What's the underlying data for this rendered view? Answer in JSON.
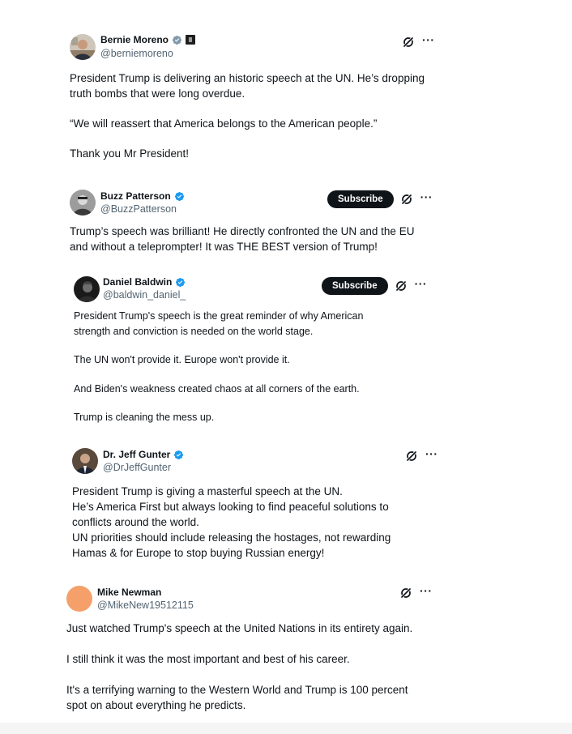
{
  "colors": {
    "verified": "#1d9bf0",
    "subscribe_bg": "#0f1419",
    "handle": "#536471",
    "mike_avatar": "#f5a06b"
  },
  "icons": {
    "verified": "verified-badge-icon",
    "grok": "grok-icon",
    "more": "more-options-icon"
  },
  "tweets": [
    {
      "name": "Bernie Moreno",
      "handle": "@berniemoreno",
      "badge": "verified-gray",
      "extra_badge": "square-affiliate-icon",
      "more": "···",
      "paragraphs": [
        "President Trump is delivering an historic speech at the UN. He’s dropping truth bombs that were long overdue.",
        "“We will reassert that America belongs to the American people.”",
        "Thank you Mr President!"
      ]
    },
    {
      "name": "Buzz Patterson",
      "handle": "@BuzzPatterson",
      "badge": "verified-blue",
      "subscribe": "Subscribe",
      "more": "···",
      "paragraphs": [
        "Trump’s speech was brilliant! He directly confronted the UN and the EU and without a teleprompter! It was THE BEST version of Trump!"
      ]
    },
    {
      "name": "Daniel Baldwin",
      "handle": "@baldwin_daniel_",
      "badge": "verified-blue",
      "subscribe": "Subscribe",
      "more": "···",
      "paragraphs": [
        "President Trump's speech is the great reminder of why American strength and conviction is needed on the world stage.",
        "The UN won't provide it. Europe won't provide it.",
        "And Biden's weakness created chaos at all corners of the earth.",
        "Trump is cleaning the mess up."
      ]
    },
    {
      "name": "Dr. Jeff Gunter",
      "handle": "@DrJeffGunter",
      "badge": "verified-blue",
      "more": "···",
      "paragraphs": [
        "President Trump is giving a masterful speech at the UN.",
        "He’s America First but always looking to find peaceful solutions to conflicts around the world.",
        "UN priorities should include releasing the hostages, not rewarding Hamas & for Europe to stop buying Russian energy!"
      ]
    },
    {
      "name": "Mike Newman",
      "handle": "@MikeNew19512115",
      "more": "···",
      "paragraphs": [
        "Just watched Trump's speech at the United Nations in its entirety again.",
        "I still think it was the most important and best of his career.",
        "It's a terrifying warning to the Western World and Trump is 100 percent spot on about everything he predicts."
      ]
    }
  ]
}
